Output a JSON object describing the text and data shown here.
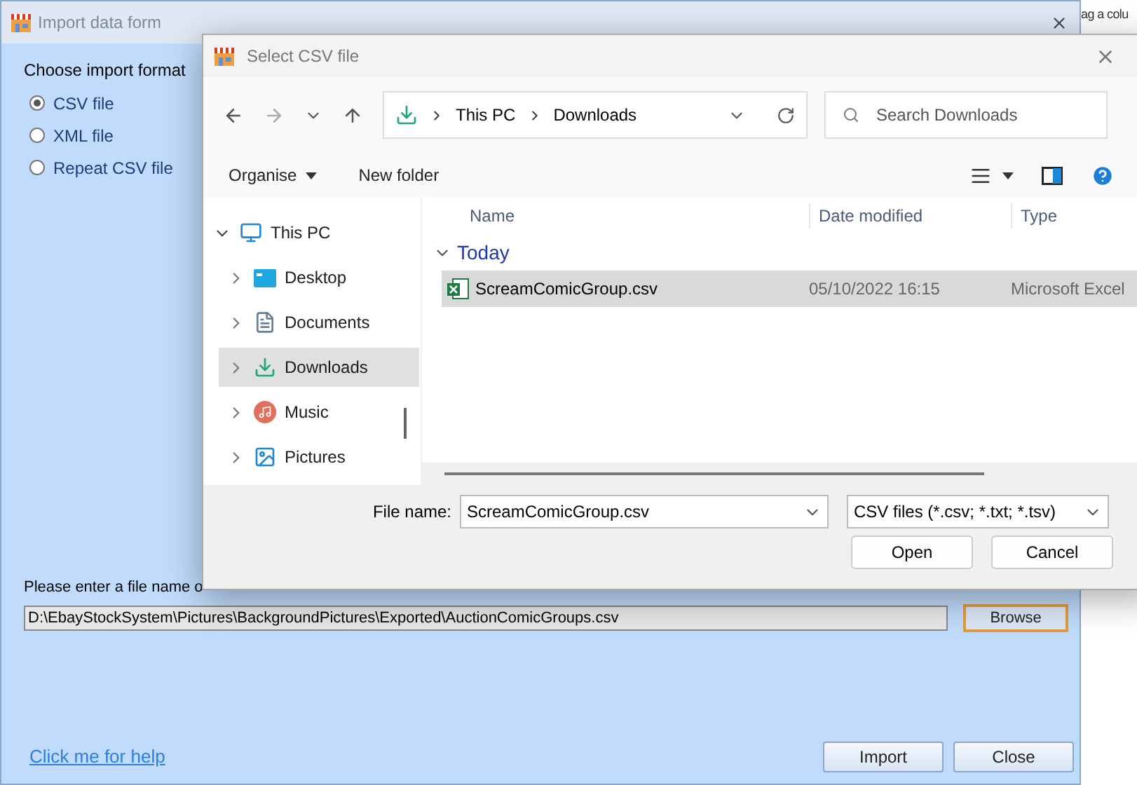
{
  "background_text": "ag a colu",
  "window": {
    "title": "Import data form"
  },
  "import_format": {
    "heading": "Choose import format",
    "options": [
      {
        "label": "CSV file",
        "selected": true
      },
      {
        "label": "XML file",
        "selected": false
      },
      {
        "label": "Repeat CSV file",
        "selected": false
      }
    ]
  },
  "file_prompt": "Please enter a file name o",
  "file_path": {
    "value": "D:\\EbayStockSystem\\Pictures\\BackgroundPictures\\Exported\\AuctionComicGroups.csv"
  },
  "browse_button": "Browse",
  "help_link": "Click me for help",
  "buttons": [
    "Import",
    "Close"
  ],
  "dialog": {
    "title": "Select CSV file",
    "breadcrumb": [
      "This PC",
      "Downloads"
    ],
    "search": {
      "placeholder": "Search Downloads"
    },
    "commands": [
      "Organise",
      "New folder"
    ],
    "sidebar": [
      {
        "label": "This PC",
        "kind": "pc",
        "expanded": true,
        "selected": false,
        "children": [
          {
            "label": "Desktop",
            "kind": "desktop",
            "expanded": false,
            "selected": false
          },
          {
            "label": "Documents",
            "kind": "documents",
            "expanded": false,
            "selected": false
          },
          {
            "label": "Downloads",
            "kind": "downloads",
            "expanded": false,
            "selected": true
          },
          {
            "label": "Music",
            "kind": "music",
            "expanded": false,
            "selected": false
          },
          {
            "label": "Pictures",
            "kind": "pictures",
            "expanded": false,
            "selected": false
          }
        ]
      }
    ],
    "columns": [
      "Name",
      "Date modified",
      "Type"
    ],
    "groups": [
      {
        "label": "Today",
        "expanded": true,
        "rows": [
          {
            "name": "ScreamComicGroup.csv",
            "date": "05/10/2022 16:15",
            "type": "Microsoft Excel",
            "selected": true
          }
        ]
      }
    ],
    "file_name_label": "File name:",
    "file_name": {
      "value": "ScreamComicGroup.csv"
    },
    "file_type": "CSV files (*.csv; *.txt; *.tsv)",
    "buttons": [
      "Open",
      "Cancel"
    ]
  }
}
